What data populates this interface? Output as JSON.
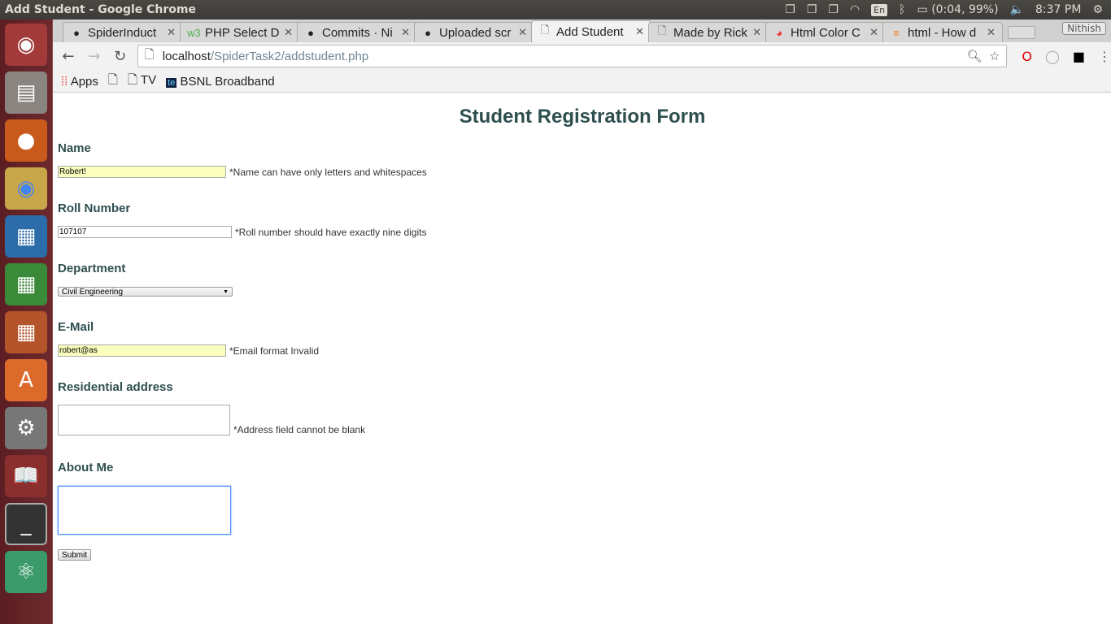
{
  "os": {
    "window_title": "Add Student - Google Chrome",
    "keyboard": "En",
    "battery": "(0:04, 99%)",
    "clock": "8:37 PM"
  },
  "browser": {
    "tabs": [
      {
        "label": "SpiderInduct",
        "icon": "github-icon"
      },
      {
        "label": "PHP Select D",
        "icon": "w3schools-icon"
      },
      {
        "label": "Commits · Ni",
        "icon": "github-icon"
      },
      {
        "label": "Uploaded scr",
        "icon": "github-icon"
      },
      {
        "label": "Add Student",
        "icon": "page-icon",
        "active": true
      },
      {
        "label": "Made by Rick",
        "icon": "page-icon"
      },
      {
        "label": "Html Color C",
        "icon": "color-wheel-icon"
      },
      {
        "label": "html - How d",
        "icon": "stackoverflow-icon"
      }
    ],
    "profile": "Nithish",
    "url_host": "localhost",
    "url_path": "/SpiderTask2/addstudent.php",
    "bookmarks": [
      "Apps",
      "",
      "TV",
      "BSNL Broadband"
    ]
  },
  "form": {
    "title": "Student Registration Form",
    "name": {
      "label": "Name",
      "value": "Robert!",
      "error": "*Name can have only letters and whitespaces"
    },
    "roll": {
      "label": "Roll Number",
      "value": "107107",
      "error": "*Roll number should have exactly nine digits"
    },
    "department": {
      "label": "Department",
      "value": "Civil Engineering"
    },
    "email": {
      "label": "E-Mail",
      "value": "robert@as",
      "error": "*Email format Invalid"
    },
    "address": {
      "label": "Residential address",
      "value": "",
      "error": "*Address field cannot be blank"
    },
    "about": {
      "label": "About Me",
      "value": ""
    },
    "submit": "Submit"
  },
  "colors": {
    "text": "#2f4f4f",
    "autofill": "#faffbd",
    "focus": "#4d90fe"
  }
}
